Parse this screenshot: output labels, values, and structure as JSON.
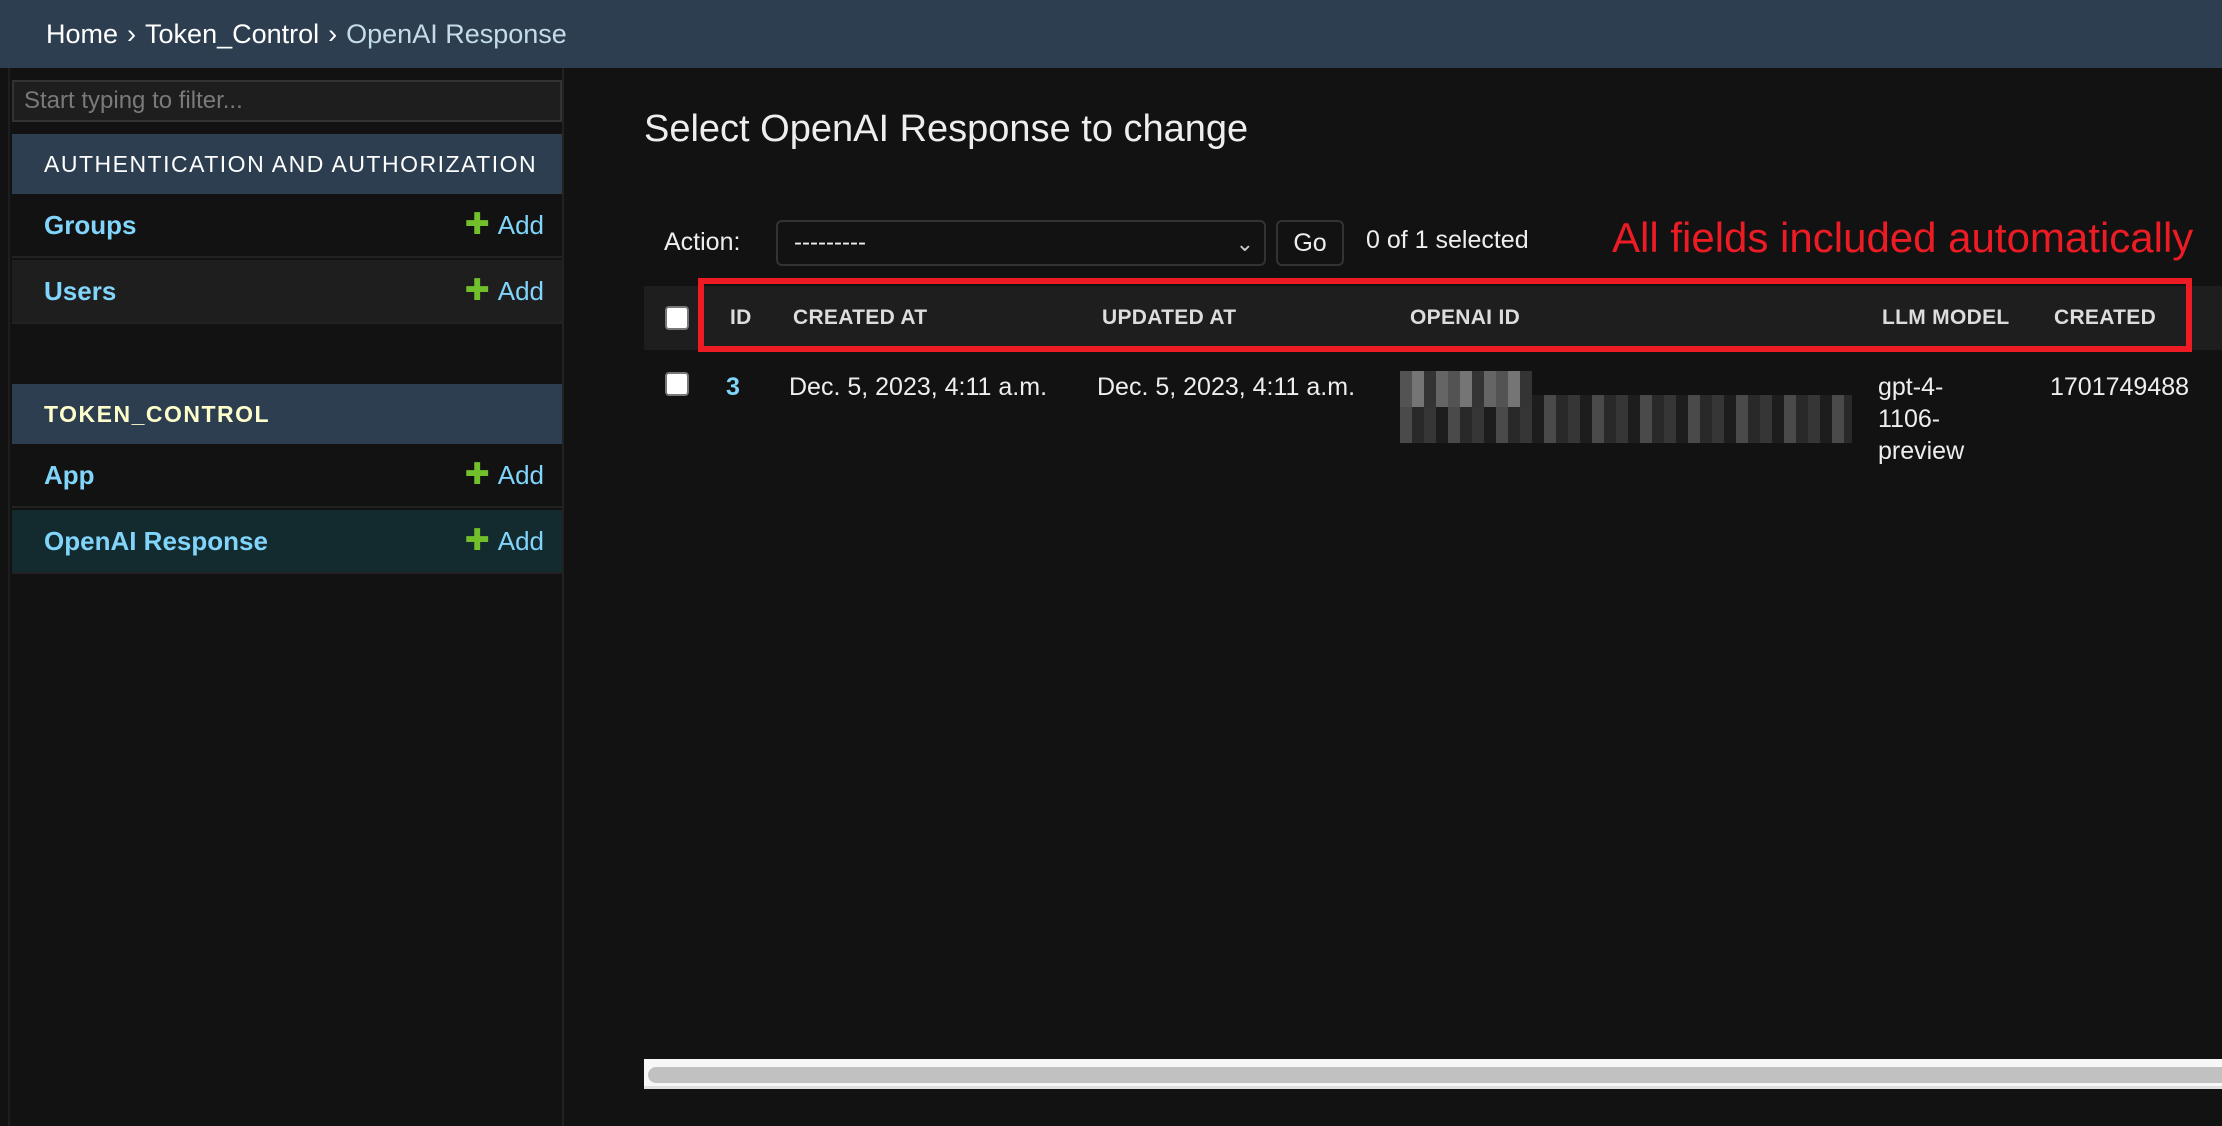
{
  "breadcrumbs": {
    "home": "Home",
    "separator": "›",
    "app": "Token_Control",
    "current": "OpenAI Response"
  },
  "sidebar": {
    "filter_placeholder": "Start typing to filter...",
    "modules": [
      {
        "caption": "AUTHENTICATION AND AUTHORIZATION",
        "models": [
          {
            "name": "Groups",
            "add_label": "Add"
          },
          {
            "name": "Users",
            "add_label": "Add"
          }
        ]
      },
      {
        "caption": "TOKEN_CONTROL",
        "models": [
          {
            "name": "App",
            "add_label": "Add"
          },
          {
            "name": "OpenAI Response",
            "add_label": "Add",
            "selected": true
          }
        ]
      }
    ],
    "add_icon": "plus-icon"
  },
  "main": {
    "title": "Select OpenAI Response to change",
    "actions": {
      "label": "Action:",
      "selected_option": "---------",
      "go_label": "Go",
      "selection_count": "0 of 1 selected"
    },
    "annotation": {
      "text": "All fields included automatically",
      "color": "#ed1c24"
    },
    "table": {
      "columns": [
        "ID",
        "CREATED AT",
        "UPDATED AT",
        "OPENAI ID",
        "LLM MODEL",
        "CREATED"
      ],
      "rows": [
        {
          "id": "3",
          "created_at": "Dec. 5, 2023, 4:11 a.m.",
          "updated_at": "Dec. 5, 2023, 4:11 a.m.",
          "openai_id": "[redacted]",
          "llm_model_lines": [
            "gpt-4-",
            "1106-",
            "preview"
          ],
          "llm_model": "gpt-4-1106-preview",
          "created": "1701749488"
        }
      ]
    }
  },
  "colors": {
    "header_bg": "#2c3e50",
    "link": "#81d4fa",
    "add_plus": "#70bf2b",
    "module_caption_highlight": "#ffffcc",
    "selected_row_bg": "#132a2f",
    "page_bg": "#121212"
  }
}
